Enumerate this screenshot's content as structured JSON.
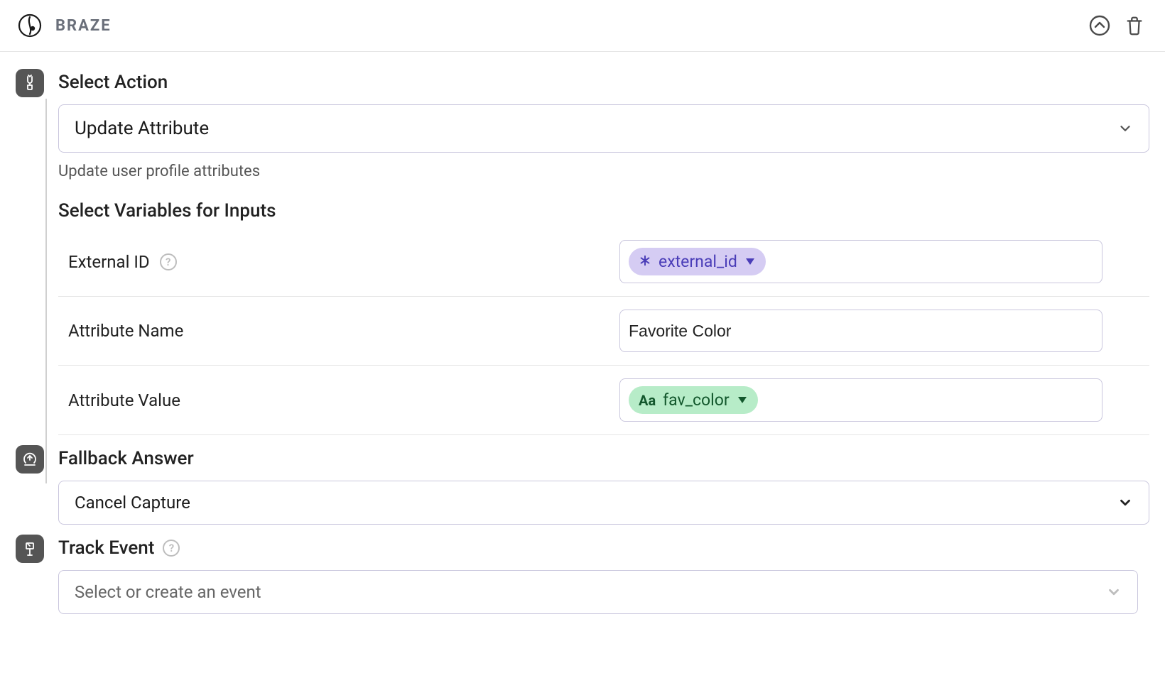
{
  "header": {
    "brand": "BRAZE"
  },
  "section_action": {
    "title": "Select Action",
    "selected": "Update Attribute",
    "description": "Update user profile attributes",
    "variables_heading": "Select Variables for Inputs",
    "rows": {
      "external_id": {
        "label": "External ID",
        "chip": "external_id"
      },
      "attribute_name": {
        "label": "Attribute Name",
        "value": "Favorite Color"
      },
      "attribute_value": {
        "label": "Attribute Value",
        "chip": "fav_color"
      }
    }
  },
  "section_fallback": {
    "title": "Fallback Answer",
    "selected": "Cancel Capture"
  },
  "section_track": {
    "title": "Track Event",
    "placeholder": "Select or create an event"
  }
}
